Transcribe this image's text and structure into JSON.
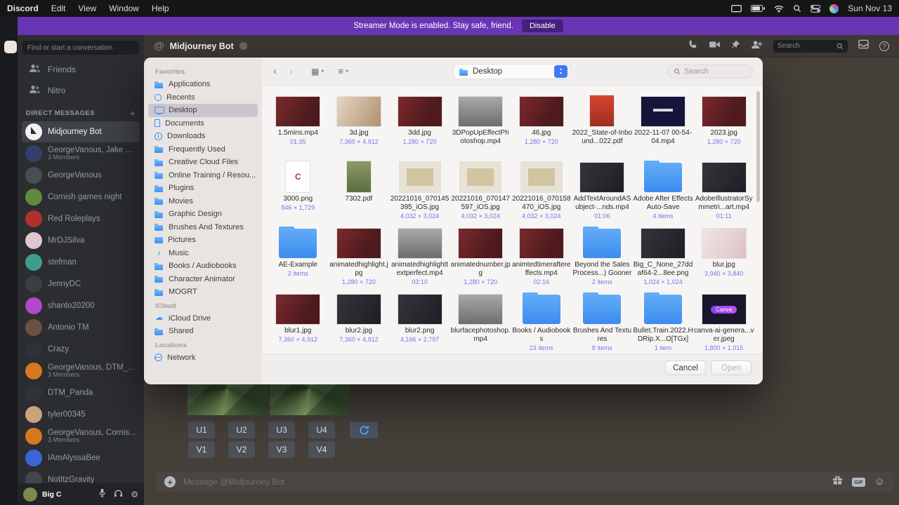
{
  "colors": {
    "banner_purple": "#6a35b4",
    "accent_blue": "#3b7af5",
    "file_info_purple": "#7a71e8",
    "folder_blue": "#3c8cf0"
  },
  "menubar": {
    "app_name": "Discord",
    "menus": [
      "Edit",
      "View",
      "Window",
      "Help"
    ],
    "status_date": "Sun Nov 13"
  },
  "banner": {
    "message": "Streamer Mode is enabled. Stay safe, friend.",
    "disable_label": "Disable"
  },
  "discord": {
    "sidebar": {
      "search_placeholder": "Find or start a conversation",
      "nav_items": [
        {
          "label": "Friends"
        },
        {
          "label": "Nitro"
        }
      ],
      "dm_header": "DIRECT MESSAGES",
      "dms": [
        {
          "name": "Midjourney Bot",
          "selected": true,
          "color": "#f2f2f2",
          "av": "sail"
        },
        {
          "name": "GeorgeVanous, Jake C...",
          "sub": "3 Members",
          "color": "#32406e"
        },
        {
          "name": "GeorgeVanous",
          "color": "#4a4d52"
        },
        {
          "name": "Cornish games night",
          "color": "#5f8a3c"
        },
        {
          "name": "Red Roleplays",
          "color": "#b03030"
        },
        {
          "name": "MrDJSilva",
          "color": "#e2c6ce"
        },
        {
          "name": "stefman",
          "color": "#3f9e8a"
        },
        {
          "name": "JennyDC",
          "color": "#3a3f44"
        },
        {
          "name": "shanto20200",
          "color": "#b048c8"
        },
        {
          "name": "Antonio TM",
          "color": "#6a5142"
        },
        {
          "name": "Crazy",
          "color": "#2e3136"
        },
        {
          "name": "GeorgeVanous, DTM_...",
          "sub": "3 Members",
          "color": "#d8781e"
        },
        {
          "name": "DTM_Panda",
          "color": "#303339"
        },
        {
          "name": "tyler00345",
          "color": "#caa27e"
        },
        {
          "name": "GeorgeVanous, Cornis...",
          "sub": "3 Members",
          "color": "#d8781e"
        },
        {
          "name": "IAmAlyssaBee",
          "color": "#3a66d8"
        },
        {
          "name": "NotItzGravity",
          "color": "#43464d"
        }
      ],
      "user": {
        "name": "Big C",
        "color": "#7a8a50"
      }
    },
    "chat": {
      "title": "Midjourney Bot",
      "search_placeholder": "Search",
      "message_placeholder": "Message @Midjourney Bot",
      "gif_label": "GIF",
      "upscale_buttons": [
        "U1",
        "U2",
        "U3",
        "U4"
      ],
      "variation_buttons": [
        "V1",
        "V2",
        "V3",
        "V4"
      ]
    }
  },
  "file_dialog": {
    "toolbar": {
      "location": "Desktop",
      "search_placeholder": "Search"
    },
    "sidebar": {
      "favorites_label": "Favorites",
      "favorites": [
        {
          "label": "Applications",
          "ic": "ic-folder"
        },
        {
          "label": "Recents",
          "ic": "ic-clock"
        },
        {
          "label": "Desktop",
          "ic": "ic-desktop",
          "selected": true
        },
        {
          "label": "Documents",
          "ic": "ic-doc"
        },
        {
          "label": "Downloads",
          "ic": "ic-download"
        },
        {
          "label": "Frequently Used",
          "ic": "ic-folder"
        },
        {
          "label": "Creative Cloud Files",
          "ic": "ic-folder"
        },
        {
          "label": "Online Training / Resou...",
          "ic": "ic-folder"
        },
        {
          "label": "Plugins",
          "ic": "ic-folder"
        },
        {
          "label": "Movies",
          "ic": "ic-folder"
        },
        {
          "label": "Graphic Design",
          "ic": "ic-folder"
        },
        {
          "label": "Brushes And Textures",
          "ic": "ic-folder"
        },
        {
          "label": "Pictures",
          "ic": "ic-picture"
        },
        {
          "label": "Music",
          "ic": "ic-music"
        },
        {
          "label": "Books / Audiobooks",
          "ic": "ic-folder"
        },
        {
          "label": "Character Animator",
          "ic": "ic-folder"
        },
        {
          "label": "MOGRT",
          "ic": "ic-folder"
        }
      ],
      "icloud_label": "iCloud",
      "icloud": [
        {
          "label": "iCloud Drive",
          "ic": "ic-cloud"
        },
        {
          "label": "Shared",
          "ic": "ic-folder"
        }
      ],
      "locations_label": "Locations",
      "locations": [
        {
          "label": "Network",
          "ic": "ic-globe"
        }
      ]
    },
    "files": [
      {
        "name": "1.5mins.mp4",
        "sub": "01:35",
        "thumb": "t-maroon"
      },
      {
        "name": "3d.jpg",
        "sub": "7,360 × 4,912",
        "thumb": "t-photo"
      },
      {
        "name": "3dd.jpg",
        "sub": "1,280 × 720",
        "thumb": "t-maroon"
      },
      {
        "name": "3DPopUpEffectPhotoshop.mp4",
        "sub": "",
        "thumb": "t-gray"
      },
      {
        "name": "46.jpg",
        "sub": "1,280 × 720",
        "thumb": "t-maroon"
      },
      {
        "name": "2022_State-of-Inbound...022.pdf",
        "sub": "",
        "thumb": "t-pdf"
      },
      {
        "name": "2022-11-07 00-54-04.mp4",
        "sub": "",
        "thumb": "t-navy"
      },
      {
        "name": "2023.jpg",
        "sub": "1,280 × 720",
        "thumb": "t-maroon"
      },
      {
        "name": "3000.png",
        "sub": "846 × 1,729",
        "thumb": "t-white",
        "thumb_text": "C"
      },
      {
        "name": "7302.pdf",
        "sub": "",
        "thumb": "t-green"
      },
      {
        "name": "20221016_070145395_iOS.jpg",
        "sub": "4,032 × 3,024",
        "thumb": "t-paper"
      },
      {
        "name": "20221016_070147597_iOS.jpg",
        "sub": "4,032 × 3,024",
        "thumb": "t-paper"
      },
      {
        "name": "20221016_070158470_iOS.jpg",
        "sub": "4,032 × 3,024",
        "thumb": "t-paper"
      },
      {
        "name": "AddTextAroundASubject-...nds.mp4",
        "sub": "01:06",
        "thumb": "t-dark"
      },
      {
        "name": "Adobe After Effects Auto-Save",
        "sub": "4 items",
        "thumb": "t-folder"
      },
      {
        "name": "AdobeIllustratorSymmetri...art.mp4",
        "sub": "01:11",
        "thumb": "t-dark"
      },
      {
        "name": "AE-Example",
        "sub": "2 items",
        "thumb": "t-folder"
      },
      {
        "name": "animatedhighlight.jpg",
        "sub": "1,280 × 720",
        "thumb": "t-maroon"
      },
      {
        "name": "animatedhighlighttextperfect.mp4",
        "sub": "03:10",
        "thumb": "t-gray"
      },
      {
        "name": "animatednumber.jpg",
        "sub": "1,280 × 720",
        "thumb": "t-maroon"
      },
      {
        "name": "animtedtimeraftereffects.mp4",
        "sub": "02:16",
        "thumb": "t-maroon"
      },
      {
        "name": "Beyond the Sales Process...) Gooner",
        "sub": "2 items",
        "thumb": "t-folder"
      },
      {
        "name": "Big_C_None_27ddaf64-2...8ee.png",
        "sub": "1,024 × 1,024",
        "thumb": "t-dark"
      },
      {
        "name": "blur.jpg",
        "sub": "3,940 × 3,840",
        "thumb": "t-pink"
      },
      {
        "name": "blur1.jpg",
        "sub": "7,360 × 4,912",
        "thumb": "t-maroon"
      },
      {
        "name": "blur2.jpg",
        "sub": "7,360 × 4,912",
        "thumb": "t-dark"
      },
      {
        "name": "blur2.png",
        "sub": "4,166 × 2,797",
        "thumb": "t-dark"
      },
      {
        "name": "blurfacephotoshop.mp4",
        "sub": "",
        "thumb": "t-gray"
      },
      {
        "name": "Books / Audiobooks",
        "sub": "23 items",
        "thumb": "t-folder"
      },
      {
        "name": "Brushes And Textures",
        "sub": "8 items",
        "thumb": "t-folder"
      },
      {
        "name": "Bullet.Train.2022.HDRip.X...O[TGx]",
        "sub": "1 item",
        "thumb": "t-folder"
      },
      {
        "name": "canva-ai-genera...ver.jpeg",
        "sub": "1,800 × 1,015",
        "thumb": "t-canva",
        "thumb_text": "Canva"
      }
    ],
    "cancel_label": "Cancel",
    "open_label": "Open"
  }
}
